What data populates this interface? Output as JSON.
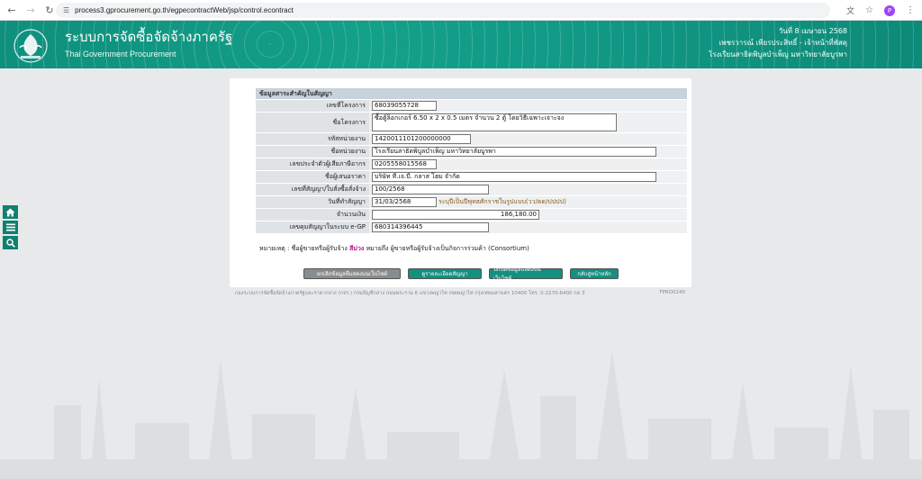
{
  "browser": {
    "url": "process3.gprocurement.go.th/egpecontractWeb/jsp/control.econtract",
    "profile_initial": "P"
  },
  "header": {
    "title_th": "ระบบการจัดซื้อจัดจ้างภาครัฐ",
    "title_en": "Thai Government Procurement",
    "date_line": "วันที่ 8 เมษายน 2568",
    "user_line": "เพชรวารณ์ เพียรประสิทธิ์ - เจ้าหน้าที่พัสดุ",
    "org_line": "โรงเรียนสาธิตพิบูลบำเพ็ญ มหาวิทยาลัยบูรพา"
  },
  "form": {
    "section_title": "ข้อมูลสาระสำคัญในสัญญา",
    "rows": [
      {
        "label": "เลขที่โครงการ",
        "value": "68039055728"
      },
      {
        "label": "ชื่อโครงการ",
        "value": "ซื้อตู้ล็อกเกอร์ 6.50 x 2 x 0.5 เมตร จำนวน 2 ตู้ โดยวิธีเฉพาะเจาะจง"
      },
      {
        "label": "รหัสหน่วยงาน",
        "value": "1420011101200000000"
      },
      {
        "label": "ชื่อหน่วยงาน",
        "value": "โรงเรียนสาธิตพิบูลบำเพ็ญ  มหาวิทยาลัยบูรพา"
      },
      {
        "label": "เลขประจำตัวผู้เสียภาษีอากร",
        "value": "0205558015568"
      },
      {
        "label": "ชื่อผู้เสนอราคา",
        "value": "บริษัท ที.เจ.บี. กลาส โฮม จำกัด"
      },
      {
        "label": "เลขที่สัญญา/ใบสั่งซื้อสั่งจ้าง",
        "value": "100/2568"
      },
      {
        "label": "วันที่ทำสัญญา",
        "value": "31/03/2568",
        "note": "ระบุปีเป็นปีพุทธศักราชในรูปแบบ(วว/ดด/ปปปป)"
      },
      {
        "label": "จำนวนเงิน",
        "value": "186,180.00"
      },
      {
        "label": "เลขคุมสัญญาในระบบ e-GP",
        "value": "680314396445"
      }
    ],
    "remark_prefix": "หมายเหตุ : ชื่อผู้ขายหรือผู้รับจ้าง",
    "remark_mark": "สีม่วง",
    "remark_suffix": "หมายถึง ผู้ขายหรือผู้รับจ้างเป็นกิจการร่วมค้า (Consortium)"
  },
  "buttons": {
    "cancel_display": "ยกเลิกข้อมูลที่แสดงบนเว็บไซต์",
    "view_contract": "ดูรายละเอียดสัญญา",
    "hide_display": "ปกปิดข้อมูลแสดงบนเว็บไซต์",
    "back_main": "กลับสู่หน้าหลัก"
  },
  "footer": {
    "address": "กองระบบการจัดซื้อจัดจ้างภาครัฐและราคากลาง (กจร.) กรมบัญชีกลาง ถนนพระราม 6 แขวงพญาไท เขตพญาไท กรุงเทพมหานคร 10400 โทร. 0-2270-6400 กด 3",
    "page_code": "FPRO0240"
  },
  "icons": {
    "home": "home-icon",
    "menu": "menu-icon",
    "search": "search-icon"
  },
  "colors": {
    "brand_teal": "#13a089",
    "consortium_mark": "#c0148b"
  }
}
